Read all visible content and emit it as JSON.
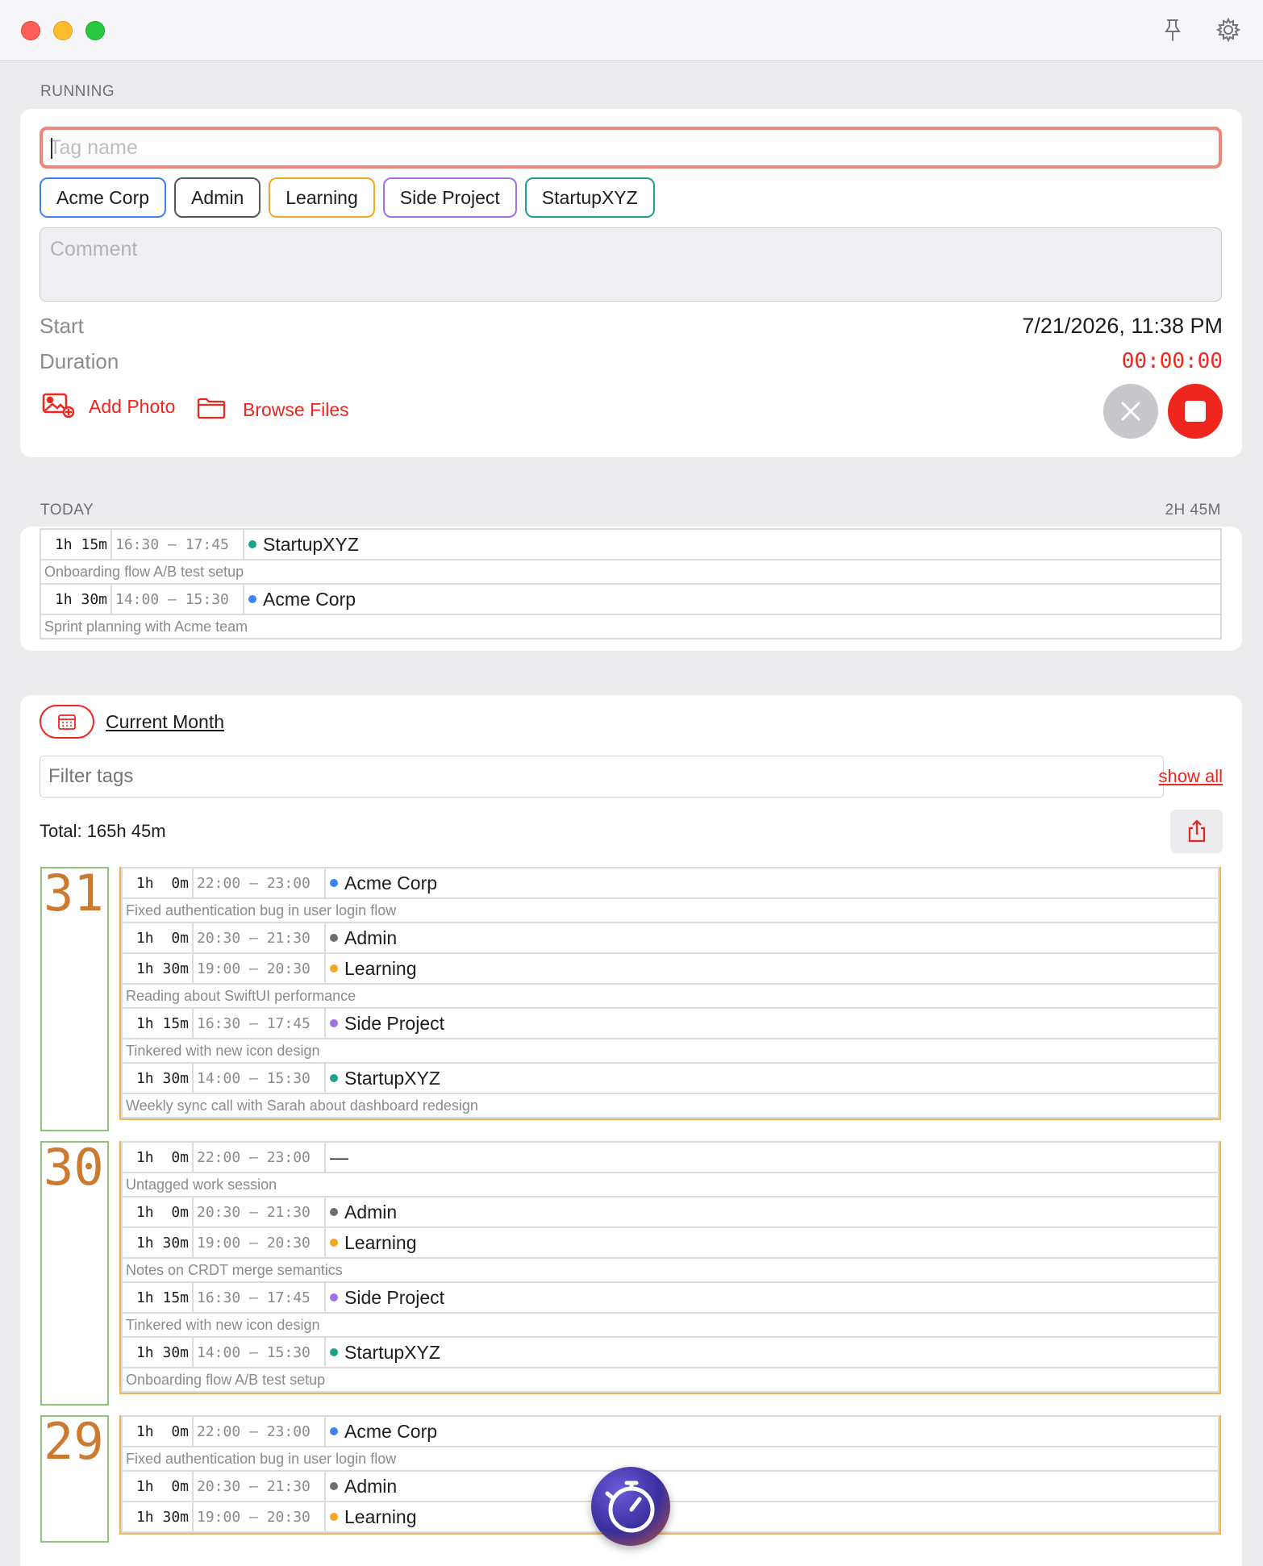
{
  "window": {
    "controls": [
      "close",
      "minimize",
      "zoom"
    ],
    "icons": [
      "pin-icon",
      "settings-gear-icon"
    ]
  },
  "running": {
    "section_label": "RUNNING",
    "tag_placeholder": "Tag name",
    "chips": [
      {
        "label": "Acme Corp",
        "color": "#3b82f6"
      },
      {
        "label": "Admin",
        "color": "#55575d"
      },
      {
        "label": "Learning",
        "color": "#f5a623"
      },
      {
        "label": "Side Project",
        "color": "#a070e8"
      },
      {
        "label": "StartupXYZ",
        "color": "#1aa38a"
      }
    ],
    "comment_placeholder": "Comment",
    "start_label": "Start",
    "start_value": "7/21/2026, 11:38 PM",
    "duration_label": "Duration",
    "duration_value": "00:00:00",
    "add_photo_label": "Add Photo",
    "browse_files_label": "Browse Files",
    "accent": "#f0251d"
  },
  "today": {
    "section_label": "TODAY",
    "total": "2H 45M",
    "entries": [
      {
        "duration": "1h 15m",
        "time": "16:30 — 17:45",
        "tag": "StartupXYZ",
        "color": "#1aa38a",
        "comment": "Onboarding flow A/B test setup"
      },
      {
        "duration": "1h 30m",
        "time": "14:00 — 15:30",
        "tag": "Acme Corp",
        "color": "#3b82f6",
        "comment": "Sprint planning with Acme team"
      }
    ]
  },
  "history": {
    "period_label": "Current Month",
    "filter_placeholder": "Filter tags",
    "show_all_label": "show all",
    "total_label": "Total: 165h 45m",
    "days": [
      {
        "day": "31",
        "entries": [
          {
            "duration": "1h  0m",
            "time": "22:00 — 23:00",
            "tag": "Acme Corp",
            "color": "#3b82f6",
            "comment": "Fixed authentication bug in user login flow"
          },
          {
            "duration": "1h  0m",
            "time": "20:30 — 21:30",
            "tag": "Admin",
            "color": "#6b6d73",
            "comment": ""
          },
          {
            "duration": "1h 30m",
            "time": "19:00 — 20:30",
            "tag": "Learning",
            "color": "#f5a623",
            "comment": "Reading about SwiftUI performance"
          },
          {
            "duration": "1h 15m",
            "time": "16:30 — 17:45",
            "tag": "Side Project",
            "color": "#a070e8",
            "comment": "Tinkered with new icon design"
          },
          {
            "duration": "1h 30m",
            "time": "14:00 — 15:30",
            "tag": "StartupXYZ",
            "color": "#1aa38a",
            "comment": "Weekly sync call with Sarah about dashboard redesign"
          }
        ]
      },
      {
        "day": "30",
        "entries": [
          {
            "duration": "1h  0m",
            "time": "22:00 — 23:00",
            "tag": "—",
            "color": "",
            "comment": "Untagged work session"
          },
          {
            "duration": "1h  0m",
            "time": "20:30 — 21:30",
            "tag": "Admin",
            "color": "#6b6d73",
            "comment": ""
          },
          {
            "duration": "1h 30m",
            "time": "19:00 — 20:30",
            "tag": "Learning",
            "color": "#f5a623",
            "comment": "Notes on CRDT merge semantics"
          },
          {
            "duration": "1h 15m",
            "time": "16:30 — 17:45",
            "tag": "Side Project",
            "color": "#a070e8",
            "comment": "Tinkered with new icon design"
          },
          {
            "duration": "1h 30m",
            "time": "14:00 — 15:30",
            "tag": "StartupXYZ",
            "color": "#1aa38a",
            "comment": "Onboarding flow A/B test setup"
          }
        ]
      },
      {
        "day": "29",
        "entries": [
          {
            "duration": "1h  0m",
            "time": "22:00 — 23:00",
            "tag": "Acme Corp",
            "color": "#3b82f6",
            "comment": "Fixed authentication bug in user login flow"
          },
          {
            "duration": "1h  0m",
            "time": "20:30 — 21:30",
            "tag": "Admin",
            "color": "#6b6d73",
            "comment": ""
          },
          {
            "duration": "1h 30m",
            "time": "19:00 — 20:30",
            "tag": "Learning",
            "color": "#f5a623",
            "comment": ""
          }
        ]
      }
    ]
  },
  "floating_badge": {
    "icon": "stopwatch-app-icon"
  }
}
